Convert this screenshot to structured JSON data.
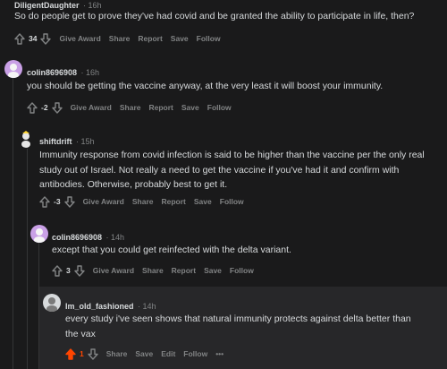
{
  "comments": [
    {
      "username": "DiligentDaughter",
      "time": "16h",
      "text": "So do people get to prove they've had covid and be granted the ability to participate in life, then?",
      "score": "34",
      "actions": [
        "Give Award",
        "Share",
        "Report",
        "Save",
        "Follow"
      ]
    },
    {
      "username": "colin8696908",
      "time": "16h",
      "text": "you should be getting the vaccine anyway, at the very least it will boost your immunity.",
      "score": "-2",
      "actions": [
        "Give Award",
        "Share",
        "Report",
        "Save",
        "Follow"
      ]
    },
    {
      "username": "shiftdrift",
      "time": "15h",
      "text_lines": [
        "Immunity response from covid infection is said to be higher than the vaccine per the only real",
        "study out of Israel. Not really a need to get the vaccine if you've had it and confirm with",
        "antibodies. Otherwise, probably best to get it."
      ],
      "score": "-3",
      "actions": [
        "Give Award",
        "Share",
        "Report",
        "Save",
        "Follow"
      ]
    },
    {
      "username": "colin8696908",
      "time": "14h",
      "text": "except that you could get reinfected with the delta variant.",
      "score": "3",
      "actions": [
        "Give Award",
        "Share",
        "Report",
        "Save",
        "Follow"
      ]
    },
    {
      "username": "Im_old_fashioned",
      "time": "14h",
      "text_lines": [
        "every study i've seen shows that natural immunity protects against delta better than",
        "the vax"
      ],
      "score": "1",
      "actions": [
        "Share",
        "Save",
        "Edit",
        "Follow",
        "•••"
      ]
    }
  ],
  "colors": {
    "background": "#1a1a1b",
    "highlight": "#272729",
    "upvote_active": "#ff4500",
    "muted": "#818384",
    "text": "#d7dadc"
  },
  "icons": [
    "upvote-icon",
    "downvote-icon",
    "avatar"
  ]
}
